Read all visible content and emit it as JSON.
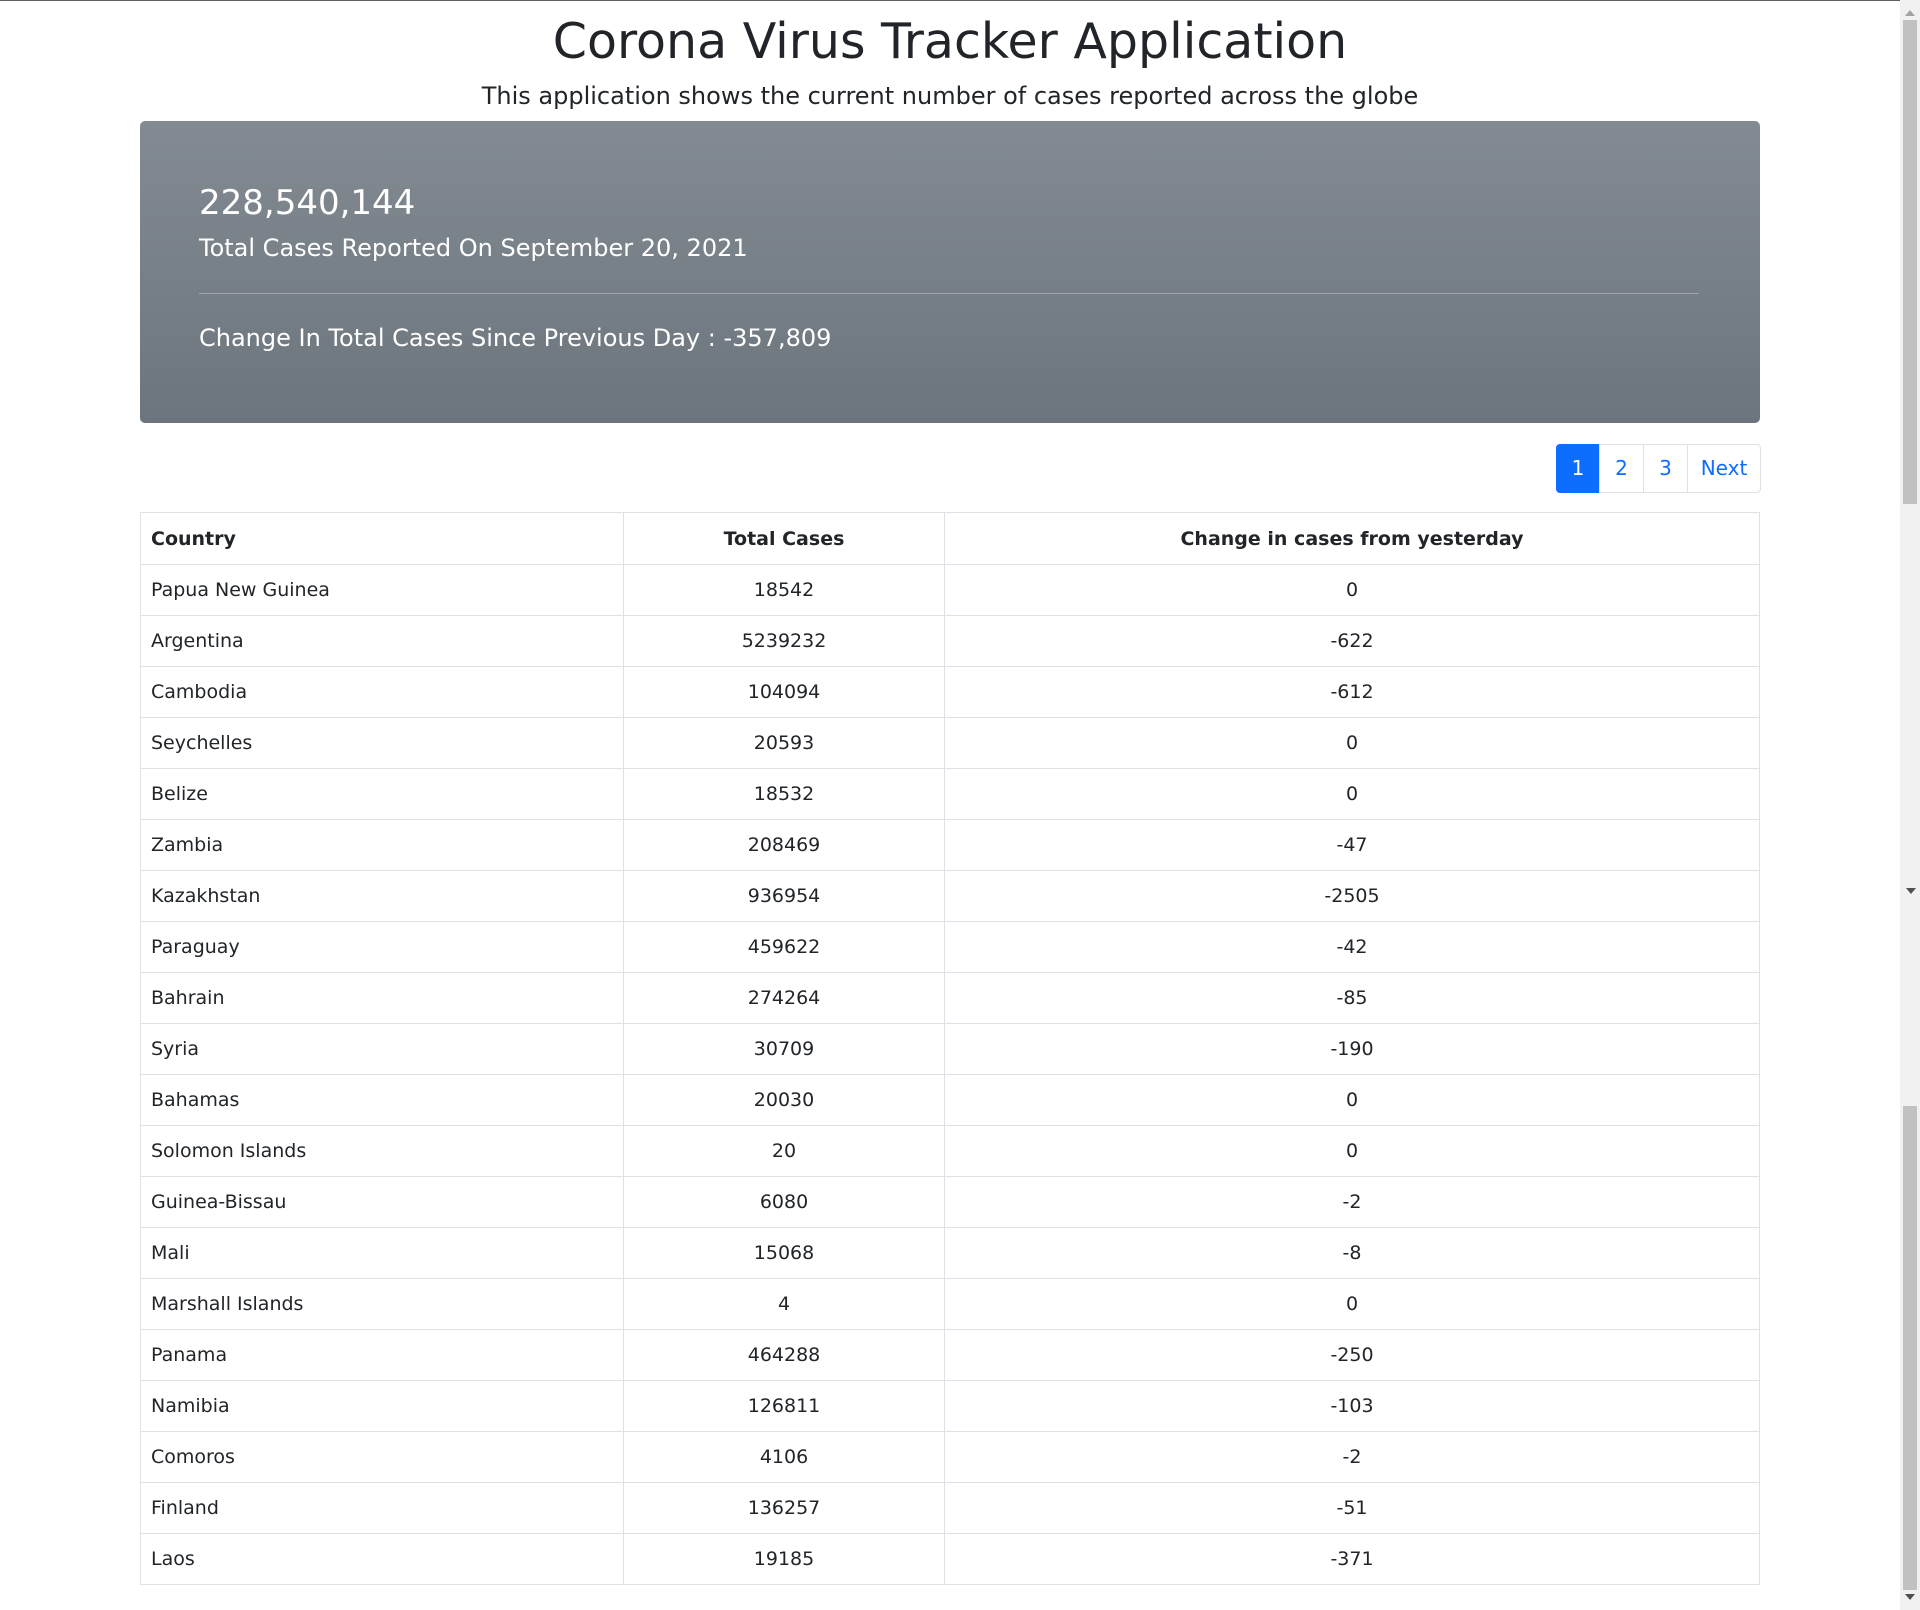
{
  "header": {
    "title": "Corona Virus Tracker Application",
    "subtitle": "This application shows the current number of cases reported across the globe"
  },
  "summary": {
    "total_cases": "228,540,144",
    "total_label": "Total Cases Reported On September 20, 2021",
    "change_text": "Change In Total Cases Since Previous Day : -357,809"
  },
  "pagination": {
    "pages": [
      "1",
      "2",
      "3"
    ],
    "active": "1",
    "next_label": "Next"
  },
  "table": {
    "columns": [
      "Country",
      "Total Cases",
      "Change in cases from yesterday"
    ],
    "rows": [
      [
        "Papua New Guinea",
        "18542",
        "0"
      ],
      [
        "Argentina",
        "5239232",
        "-622"
      ],
      [
        "Cambodia",
        "104094",
        "-612"
      ],
      [
        "Seychelles",
        "20593",
        "0"
      ],
      [
        "Belize",
        "18532",
        "0"
      ],
      [
        "Zambia",
        "208469",
        "-47"
      ],
      [
        "Kazakhstan",
        "936954",
        "-2505"
      ],
      [
        "Paraguay",
        "459622",
        "-42"
      ],
      [
        "Bahrain",
        "274264",
        "-85"
      ],
      [
        "Syria",
        "30709",
        "-190"
      ],
      [
        "Bahamas",
        "20030",
        "0"
      ],
      [
        "Solomon Islands",
        "20",
        "0"
      ],
      [
        "Guinea-Bissau",
        "6080",
        "-2"
      ],
      [
        "Mali",
        "15068",
        "-8"
      ],
      [
        "Marshall Islands",
        "4",
        "0"
      ],
      [
        "Panama",
        "464288",
        "-250"
      ],
      [
        "Namibia",
        "126811",
        "-103"
      ],
      [
        "Comoros",
        "4106",
        "-2"
      ],
      [
        "Finland",
        "136257",
        "-51"
      ],
      [
        "Laos",
        "19185",
        "-371"
      ]
    ]
  },
  "colors": {
    "accent": "#0d6efd",
    "jumbotron": "#6c757d"
  }
}
